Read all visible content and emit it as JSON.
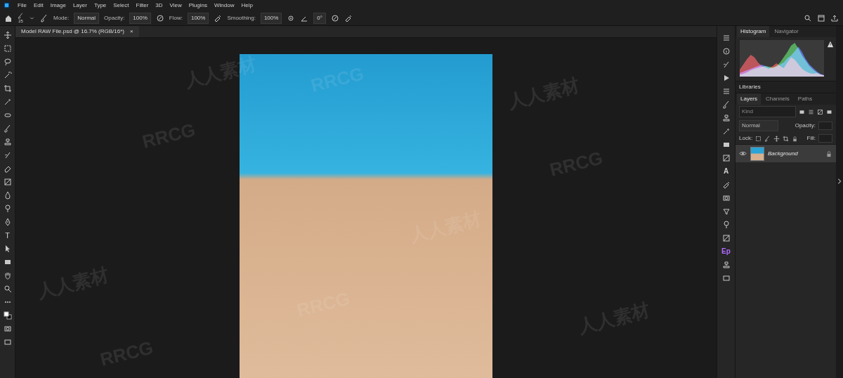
{
  "window": {
    "title": "Model RAW File.psd @ 16.7% (RGB/16*)",
    "close": "×"
  },
  "menu": [
    "File",
    "Edit",
    "Image",
    "Layer",
    "Type",
    "Select",
    "Filter",
    "3D",
    "View",
    "Plugins",
    "Window",
    "Help"
  ],
  "options": {
    "brush_size": "25",
    "mode_label": "Mode:",
    "mode": "Normal",
    "opacity_label": "Opacity:",
    "opacity": "100%",
    "flow_label": "Flow:",
    "flow": "100%",
    "smoothing_label": "Smoothing:",
    "smoothing": "100%",
    "angle": "0°"
  },
  "tools": {
    "type": "T"
  },
  "strip": {
    "character": "A",
    "extension": "Ep"
  },
  "histogram": {
    "tabs": [
      {
        "label": "Histogram",
        "selected": true
      },
      {
        "label": "Navigator",
        "selected": false
      }
    ],
    "series": [
      {
        "color": "#e0303a",
        "values": [
          20,
          35,
          50,
          62,
          55,
          40,
          30,
          26,
          22,
          30,
          38,
          30,
          24,
          40,
          55,
          48,
          35,
          22,
          15,
          10,
          8,
          10,
          6,
          4
        ]
      },
      {
        "color": "#30c040",
        "values": [
          5,
          8,
          12,
          18,
          22,
          25,
          28,
          30,
          28,
          26,
          30,
          40,
          55,
          70,
          88,
          96,
          80,
          60,
          45,
          30,
          20,
          12,
          6,
          3
        ]
      },
      {
        "color": "#3a5cff",
        "values": [
          10,
          14,
          18,
          22,
          26,
          30,
          34,
          30,
          26,
          24,
          28,
          34,
          40,
          52,
          60,
          72,
          85,
          70,
          50,
          35,
          25,
          15,
          8,
          4
        ]
      }
    ]
  },
  "libraries": {
    "label": "Libraries"
  },
  "layers": {
    "tabs": [
      {
        "label": "Layers",
        "selected": true
      },
      {
        "label": "Channels",
        "selected": false
      },
      {
        "label": "Paths",
        "selected": false
      }
    ],
    "search": {
      "placeholder": "Kind"
    },
    "blend": "Normal",
    "opacity_label": "Opacity:",
    "lock_label": "Lock:",
    "fill_label": "Fill:",
    "items": [
      {
        "name": "Background",
        "visible": true,
        "locked": true,
        "selected": true
      }
    ]
  },
  "watermarks": [
    "RRCG",
    "人人素材"
  ]
}
